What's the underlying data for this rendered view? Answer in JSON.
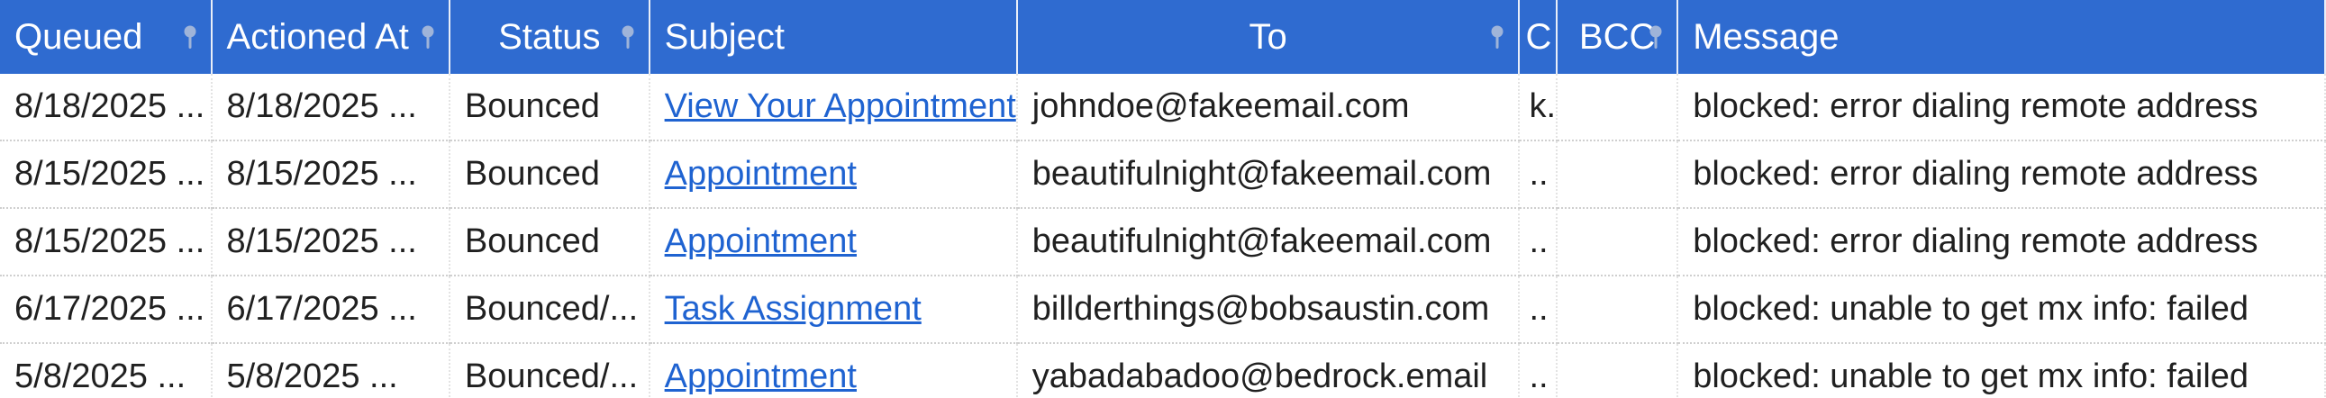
{
  "columns": {
    "queued": "Queued",
    "actioned_at": "Actioned At",
    "status": "Status",
    "subject": "Subject",
    "to": "To",
    "cc": "C",
    "bcc": "BCC",
    "message": "Message"
  },
  "icons": {
    "filter": "filter-pin-icon"
  },
  "colors": {
    "header_bg": "#2f6bd0",
    "link": "#1f63d1"
  },
  "rows": [
    {
      "queued": "8/18/2025 ...",
      "actioned_at": "8/18/2025 ...",
      "status": "Bounced",
      "subject": "View Your Appointment",
      "to": "johndoe@fakeemail.com",
      "cc": "k.",
      "bcc": "",
      "message": "blocked: error dialing remote address"
    },
    {
      "queued": "8/15/2025 ...",
      "actioned_at": "8/15/2025 ...",
      "status": "Bounced",
      "subject": "Appointment",
      "to": "beautifulnight@fakeemail.com",
      "cc": "..",
      "bcc": "",
      "message": "blocked: error dialing remote address"
    },
    {
      "queued": "8/15/2025 ...",
      "actioned_at": "8/15/2025 ...",
      "status": "Bounced",
      "subject": "Appointment",
      "to": "beautifulnight@fakeemail.com",
      "cc": "..",
      "bcc": "",
      "message": "blocked: error dialing remote address"
    },
    {
      "queued": "6/17/2025 ...",
      "actioned_at": "6/17/2025 ...",
      "status": "Bounced/...",
      "subject": "Task Assignment",
      "to": "billderthings@bobsaustin.com",
      "cc": "..",
      "bcc": "",
      "message": "blocked: unable to get mx info: failed"
    },
    {
      "queued": "5/8/2025 ...",
      "actioned_at": "5/8/2025 ...",
      "status": "Bounced/...",
      "subject": "Appointment",
      "to": "yabadabadoo@bedrock.email",
      "cc": "..",
      "bcc": "",
      "message": "blocked: unable to get mx info: failed"
    }
  ]
}
